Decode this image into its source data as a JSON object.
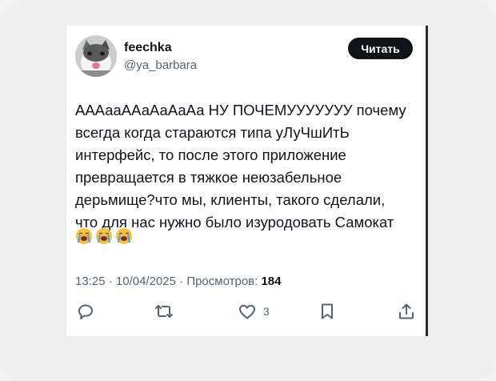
{
  "tweet": {
    "author": {
      "display_name": "feechka",
      "handle": "@ya_barbara"
    },
    "follow_label": "Читать",
    "text": "АААааААаАаАаАа НУ ПОЧЕМУУУУУУУ почему\nвсегда когда стараются типа уЛуЧшИтЬ\nинтерфейс, то после этого приложение\nпревращается в тяжкое неюзабельное\nдерьмище?что мы, клиенты, такого сделали,\nчто для нас нужно было изуродовать Самокат",
    "emojis": [
      "loudly-crying-face",
      "loudly-crying-face",
      "loudly-crying-face"
    ],
    "time": "13:25",
    "date": "10/04/2025",
    "separator": "·",
    "views_label": "Просмотров:",
    "views_count": "184",
    "like_count": "3",
    "actions": [
      "reply-icon",
      "retweet-icon",
      "like-icon",
      "bookmark-icon",
      "share-icon"
    ]
  }
}
